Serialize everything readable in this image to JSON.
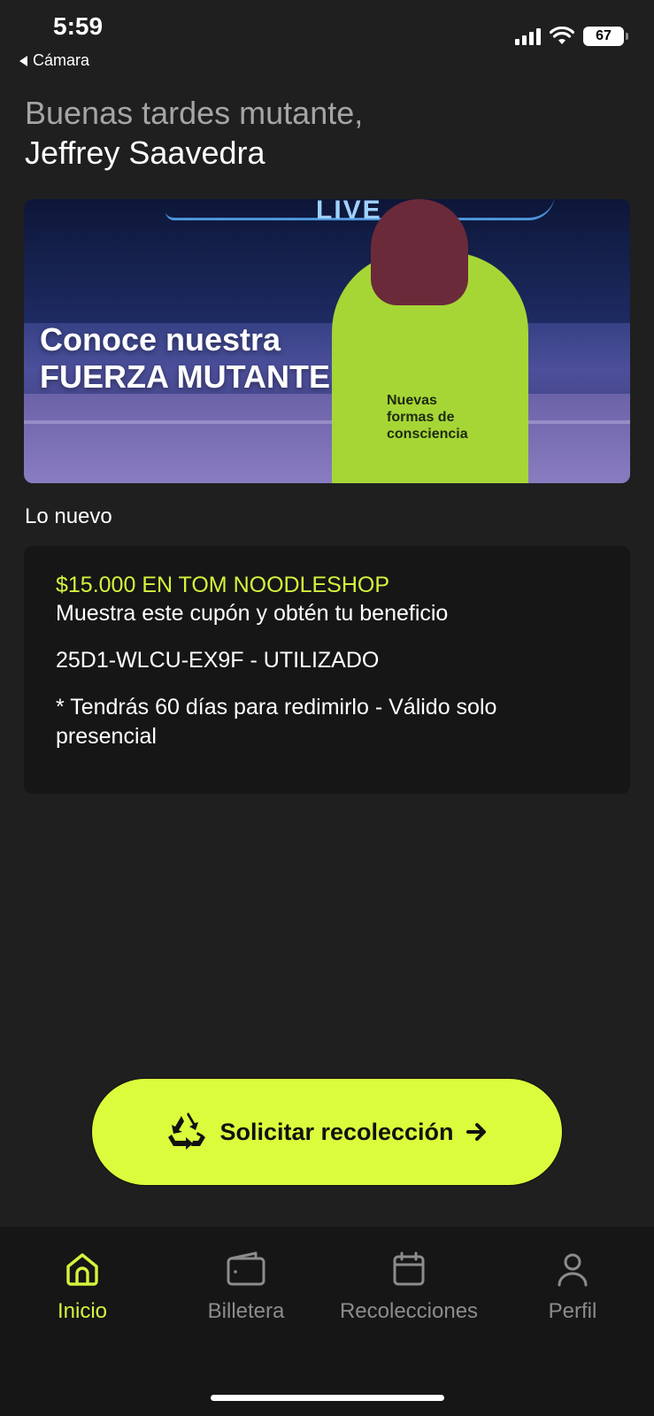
{
  "status_bar": {
    "time": "5:59",
    "back_app": "Cámara",
    "battery": "67"
  },
  "greeting": {
    "line1": "Buenas tardes mutante,",
    "line2": "Jeffrey Saavedra"
  },
  "banner": {
    "title_line1": "Conoce nuestra",
    "title_line2": "FUERZA MUTANTE",
    "neon_text": "LIVE",
    "hood_text_line1": "Nuevas",
    "hood_text_line2": "formas de",
    "hood_text_line3": "consciencia"
  },
  "section": {
    "title": "Lo nuevo"
  },
  "coupon": {
    "promo": "$15.000 EN TOM NOODLESHOP",
    "description": "Muestra este cupón y obtén tu beneficio",
    "code": "25D1-WLCU-EX9F - UTILIZADO",
    "note": "* Tendrás 60 días para redimirlo - Válido solo presencial"
  },
  "cta": {
    "label": "Solicitar recolección",
    "icon": "recycle-icon"
  },
  "nav": {
    "items": [
      {
        "label": "Inicio",
        "icon": "home-icon",
        "active": true
      },
      {
        "label": "Billetera",
        "icon": "wallet-icon",
        "active": false
      },
      {
        "label": "Recolecciones",
        "icon": "calendar-icon",
        "active": false
      },
      {
        "label": "Perfil",
        "icon": "user-icon",
        "active": false
      }
    ]
  },
  "colors": {
    "background": "#1f1f1f",
    "card": "#161616",
    "accent": "#d7f23c",
    "cta": "#dafc3c",
    "muted": "#8c8c8c"
  }
}
